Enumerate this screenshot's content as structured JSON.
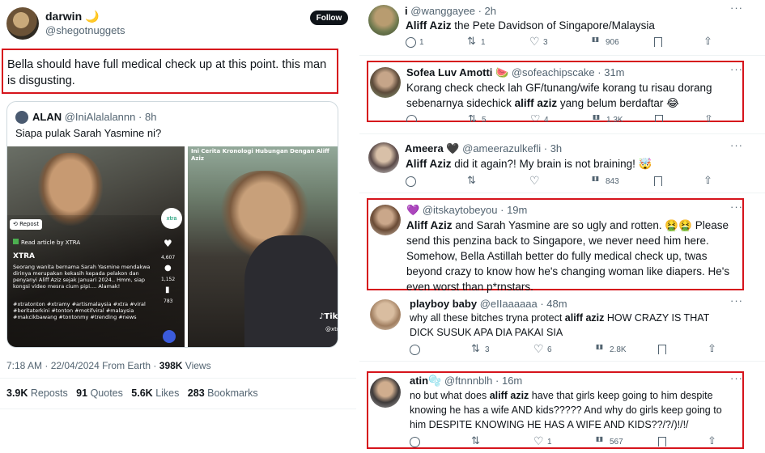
{
  "main_tweet": {
    "name": "darwin 🌙",
    "handle": "@shegotnuggets",
    "follow_label": "Follow",
    "text": "Bella should have full medical check up at this point. this man is disgusting.",
    "quoted": {
      "name": "ALAN",
      "handle": "@IniAlalalannn",
      "time": "8h",
      "text": "Siapa pulak Sarah Yasmine ni?",
      "overlay_left": {
        "repost": "Repost",
        "read_article": "Read article by XTRA",
        "brand": "XTRA",
        "body": "Seorang wanita bernama Sarah Yasmine mendakwa dirinya merupakan kekasih kepada pelakon dan penyanyi Aliff Aziz sejak Januari 2024.. Hmm, siap kongsi video mesra cium pipi.... Alamak!",
        "hashtags": "#xtratonton #xtramy #artismalaysia #xtra #viral #beritaterkini #tonton #motifviral #malaysia #makcikbawang #tontonmy #trending #news",
        "badge": "xtra",
        "likes": "4,607",
        "comments": "1,152",
        "bookmarks": "783"
      },
      "overlay_right": {
        "caption": "Ini Cerita Kronologi Hubungan Dengan Aliff Aziz",
        "tiktok": "TikTok",
        "tiktok_handle": "@xtra_my"
      }
    },
    "timestamp": "7:18 AM · 22/04/2024 From Earth · ",
    "views_count": "398K",
    "views_label": "Views",
    "stats": {
      "reposts_count": "3.9K",
      "reposts_label": "Reposts",
      "quotes_count": "91",
      "quotes_label": "Quotes",
      "likes_count": "5.6K",
      "likes_label": "Likes",
      "bookmarks_count": "283",
      "bookmarks_label": "Bookmarks"
    }
  },
  "replies": [
    {
      "name": "i",
      "handle": "@wanggayee",
      "time": "2h",
      "text_bold": "Aliff Aziz",
      "text_rest": " the Pete Davidson of Singapore/Malaysia",
      "replies": "1",
      "reposts": "1",
      "likes": "3",
      "views": "906"
    },
    {
      "name": "Sofea Luv Amotti 🍉",
      "handle": "@sofeachipscake",
      "time": "31m",
      "text_pre": "Korang check check lah GF/tunang/wife korang tu risau dorang sebenarnya sidechick ",
      "text_bold": "aliff aziz",
      "text_rest": " yang belum berdaftar 😂",
      "replies": "",
      "reposts": "5",
      "likes": "4",
      "views": "1.3K"
    },
    {
      "name": "Ameera 🖤",
      "handle": "@ameerazulkefli",
      "time": "3h",
      "text_bold": "Aliff Aziz",
      "text_rest": " did it again?! My brain is not braining! 🤯",
      "replies": "",
      "reposts": "",
      "likes": "",
      "views": "843"
    },
    {
      "name": "💜",
      "handle": "@itskaytobeyou",
      "time": "19m",
      "text_bold": "Aliff Aziz",
      "text_rest": " and Sarah Yasmine are so ugly and rotten. 🤮🤮 Please send this penzina back to Singapore, we never need him here. Somehow, Bella Astillah better do fully medical check up, twas beyond crazy to know how he's changing woman like diapers. He's even worst than p*rnstars."
    },
    {
      "name": "playboy baby",
      "handle": "@eIIaaaaaa",
      "time": "48m",
      "text_pre": "why all these bitches tryna protect ",
      "text_bold": "aliff aziz",
      "text_rest": " HOW CRAZY IS THAT DICK SUSUK APA DIA PAKAI SIA",
      "replies": "",
      "reposts": "3",
      "likes": "6",
      "views": "2.8K"
    },
    {
      "name": "atin🫧",
      "handle": "@ftnnnblh",
      "time": "16m",
      "text_pre": "no but what does ",
      "text_bold": "aliff aziz",
      "text_rest": " have that girls keep going to him despite knowing he has a wife AND kids????? And why do girls keep going to him DESPITE KNOWING HE HAS A WIFE AND KIDS??/?/)!/!/",
      "replies": "",
      "reposts": "",
      "likes": "1",
      "views": "567"
    }
  ],
  "colors": {
    "highlight_border": "#d6141c",
    "text": "#0f1419",
    "muted": "#536471"
  }
}
